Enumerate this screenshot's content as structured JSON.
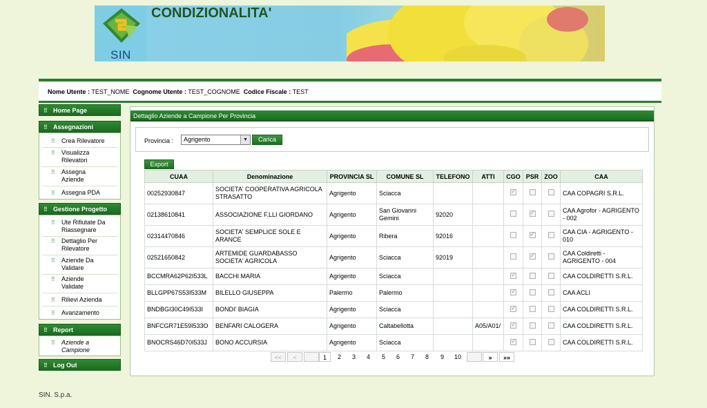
{
  "banner": {
    "logo_text": "SIN",
    "title": "CONDIZIONALITA'"
  },
  "user": {
    "nome_label": "Nome Utente :",
    "nome_value": "TEST_NOME",
    "cognome_label": "Cognome Utente :",
    "cognome_value": "TEST_COGNOME",
    "cf_label": "Codice Fiscale :",
    "cf_value": "TEST"
  },
  "sidebar": {
    "home": "Home Page",
    "assegnazioni": {
      "title": "Assegnazioni",
      "items": [
        "Crea Rilevatore",
        "Visualizza Rilevatori",
        "Assegna Aziende",
        "Assegna PDA"
      ]
    },
    "gestione": {
      "title": "Gestione Progetto",
      "items": [
        "Ute Rifiutate Da Riassegnare",
        "Dettaglio Per Rilevatore",
        "Aziende Da Validare",
        "Aziende Validate",
        "Rilievi Azienda",
        "Avanzamento"
      ]
    },
    "report": {
      "title": "Report",
      "items": [
        "Aziende a Campione"
      ]
    },
    "logout": "Log Out"
  },
  "main": {
    "title": "Dettaglio Aziende a Campione Per Provincia",
    "provincia_label": "Provincia :",
    "provincia_value": "Agrigento",
    "carica": "Carica",
    "export": "Export",
    "columns": [
      "CUAA",
      "Denominazione",
      "PROVINCIA SL",
      "COMUNE SL",
      "TELEFONO",
      "ATTI",
      "CGO",
      "PSR",
      "ZOO",
      "CAA"
    ],
    "rows": [
      {
        "cuaa": "00252930847",
        "den": "SOCIETA' COOPERATIVA AGRICOLA STRASATTO",
        "prov": "Agrigento",
        "com": "Sciacca",
        "tel": "",
        "atti": "",
        "cgo": true,
        "psr": false,
        "zoo": false,
        "caa": "CAA COPAGRI S.R.L."
      },
      {
        "cuaa": "02138610841",
        "den": "ASSOCIAZIONE F.LLI GIORDANO",
        "prov": "Agrigento",
        "com": "San Giovanni Gemini",
        "tel": "92020",
        "atti": "",
        "cgo": false,
        "psr": true,
        "zoo": false,
        "caa": "CAA Agrofor - AGRIGENTO - 002"
      },
      {
        "cuaa": "02314470846",
        "den": "SOCIETA' SEMPLICE SOLE E ARANCE",
        "prov": "Agrigento",
        "com": "Ribera",
        "tel": "92016",
        "atti": "",
        "cgo": false,
        "psr": true,
        "zoo": false,
        "caa": "CAA CIA - AGRIGENTO - 010"
      },
      {
        "cuaa": "02521650842",
        "den": "ARTEMIDE GUARDABASSO SOCIETA' AGRICOLA",
        "prov": "Agrigento",
        "com": "Sciacca",
        "tel": "92019",
        "atti": "",
        "cgo": false,
        "psr": true,
        "zoo": false,
        "caa": "CAA Coldiretti - AGRIGENTO - 004"
      },
      {
        "cuaa": "BCCMRA62P62I533L",
        "den": "BACCHI MARIA",
        "prov": "Agrigento",
        "com": "Sciacca",
        "tel": "",
        "atti": "",
        "cgo": true,
        "psr": false,
        "zoo": false,
        "caa": "CAA COLDIRETTI S.R.L."
      },
      {
        "cuaa": "BLLGPP67S53I533M",
        "den": "BILELLO GIUSEPPA",
        "prov": "Palermo",
        "com": "Palermo",
        "tel": "",
        "atti": "",
        "cgo": true,
        "psr": false,
        "zoo": false,
        "caa": "CAA ACLI"
      },
      {
        "cuaa": "BNDBGI30C49I533I",
        "den": "BONDI' BIAGIA",
        "prov": "Agrigento",
        "com": "Sciacca",
        "tel": "",
        "atti": "",
        "cgo": true,
        "psr": false,
        "zoo": false,
        "caa": "CAA COLDIRETTI S.R.L."
      },
      {
        "cuaa": "BNFCGR71E59I533O",
        "den": "BENFARI CALOGERA",
        "prov": "Agrigento",
        "com": "Caltabellotta",
        "tel": "",
        "atti": "A05/A01/",
        "cgo": true,
        "psr": false,
        "zoo": false,
        "caa": "CAA COLDIRETTI S.R.L."
      },
      {
        "cuaa": "BNOCRS46D70I533J",
        "den": "BONO ACCURSIA",
        "prov": "Agrigento",
        "com": "Sciacca",
        "tel": "",
        "atti": "",
        "cgo": true,
        "psr": false,
        "zoo": false,
        "caa": "CAA COLDIRETTI S.R.L."
      }
    ],
    "pager": {
      "first": "<<",
      "prev": "<",
      "pages": [
        "1",
        "2",
        "3",
        "4",
        "5",
        "6",
        "7",
        "8",
        "9",
        "10"
      ],
      "current": "1",
      "next": "»",
      "last": "»»"
    }
  },
  "footer": "SIN. S.p.a."
}
